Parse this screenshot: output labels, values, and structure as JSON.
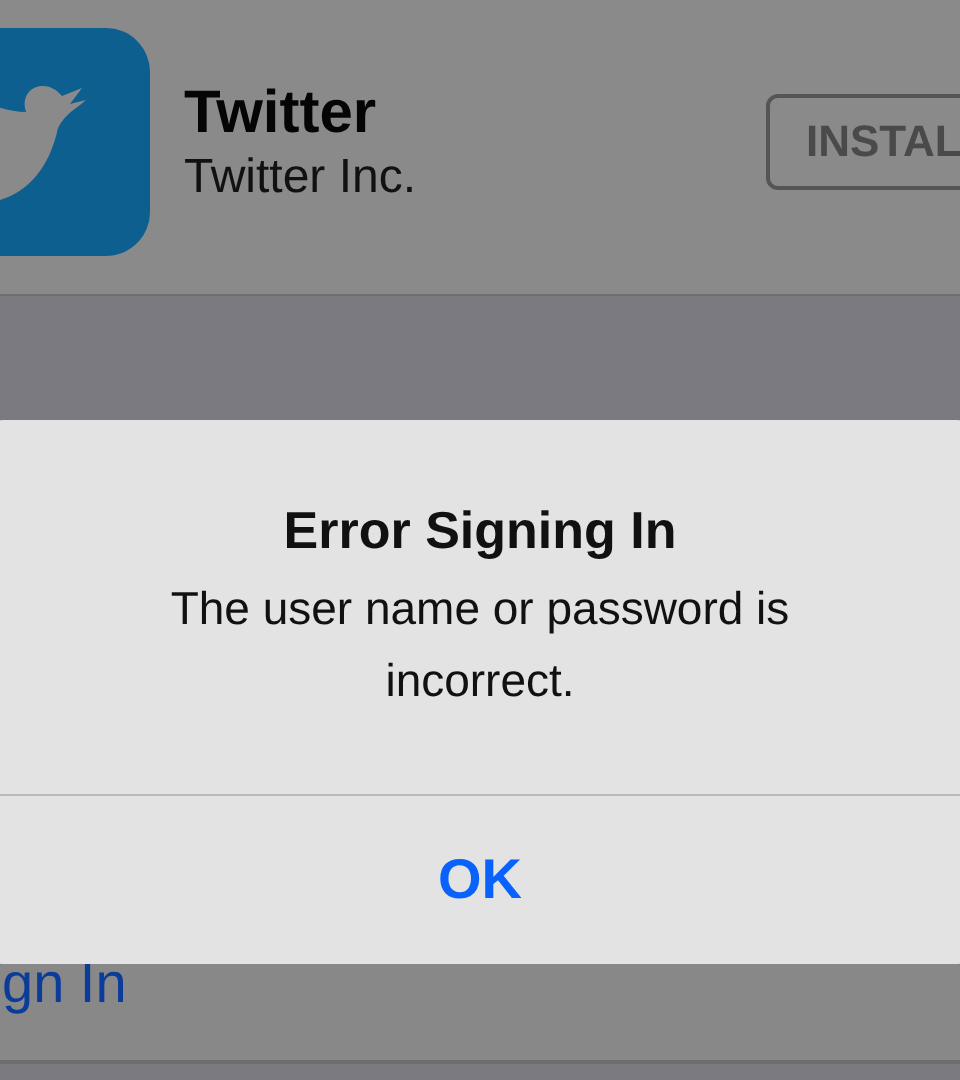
{
  "app": {
    "name": "Twitter",
    "developer": "Twitter Inc.",
    "install_button": "INSTAL"
  },
  "sign_in": {
    "label": "gn In"
  },
  "alert": {
    "title": "Error Signing In",
    "message": "The user name or password is incorrect.",
    "buttons": [
      "OK"
    ]
  }
}
